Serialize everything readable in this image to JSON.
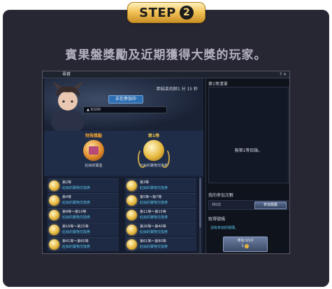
{
  "step": {
    "label": "STEP",
    "number": "2"
  },
  "headline": "賓果盤獎勵及近期獲得大獎的玩家。",
  "window": {
    "title": "尋寶",
    "buttons": "? ×"
  },
  "banner": {
    "countdown": "距結束尚餘1 分 15 秒",
    "joining_label": "正在參加中",
    "progress_text": "0/100",
    "progress_value": 0
  },
  "top_rewards": [
    {
      "label": "特殊獎勵",
      "caption": "紅絲的寶盒",
      "color": "#f0a030"
    },
    {
      "label": "第1等",
      "caption": "紅絲的寶物交換券",
      "color": "#e8c24a"
    }
  ],
  "reward_list": [
    {
      "rank": "第2等",
      "name": "紅絲的寶物交換券"
    },
    {
      "rank": "第3等",
      "name": "紅絲的寶物交換券"
    },
    {
      "rank": "第4等",
      "name": "紅絲的寶物交換券"
    },
    {
      "rank": "第5等～第7等",
      "name": "紅絲的寶物交換券"
    },
    {
      "rank": "第8等～第10等",
      "name": "紅絲的寶物交換券"
    },
    {
      "rank": "第11等～第15等",
      "name": "紅絲的寶物交換券"
    },
    {
      "rank": "第16等～第25等",
      "name": "紅絲的寶物交換券"
    },
    {
      "rank": "第26等～第40等",
      "name": "紅絲的寶物交換券"
    },
    {
      "rank": "第41等～第60等",
      "name": "紅絲的寶物交換券"
    },
    {
      "rank": "第61等～第80等",
      "name": "紅絲的寶物交換券"
    }
  ],
  "right_panel": {
    "winners_title": "第1等清單",
    "winners_empty": "無第1等目錄。",
    "my_count_title": "我的參加次數",
    "my_count_value": "共0次",
    "join_effect_button": "參加獎勵",
    "take_number_title": "取得號碼",
    "not_joined_hint": "沒有參加的號碼。",
    "join_button_label": "參加",
    "join_button_count": "0/10",
    "join_button_cost": "1"
  },
  "colors": {
    "accent": "#57c4ee",
    "gold": "#e6b73d",
    "panel": "#272633"
  }
}
